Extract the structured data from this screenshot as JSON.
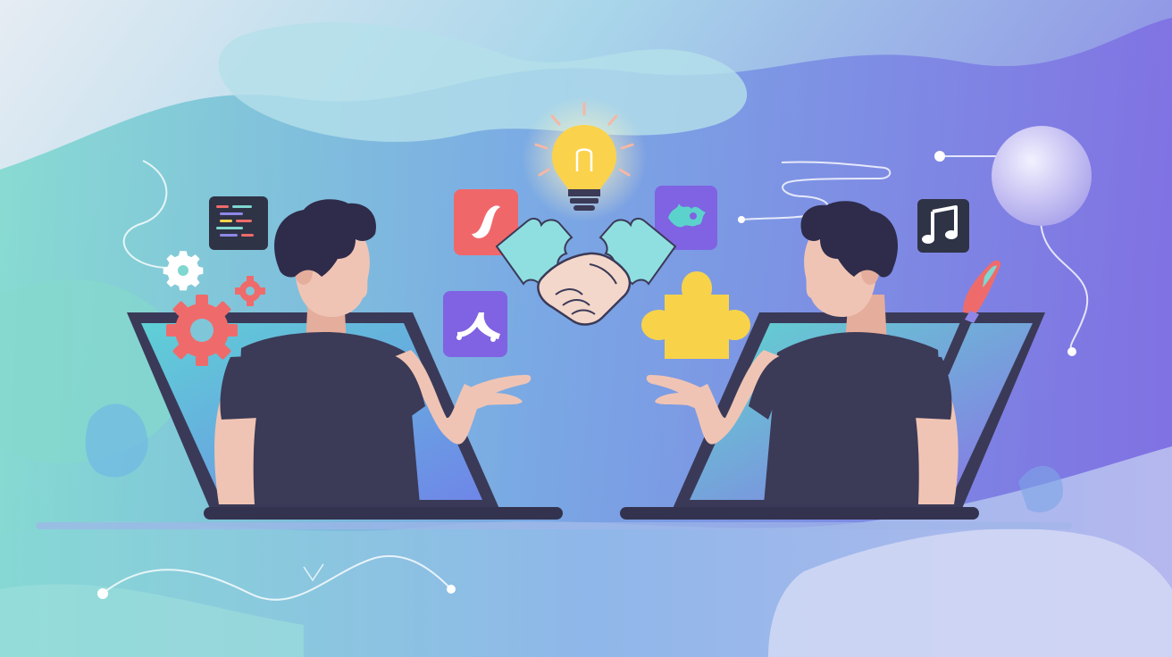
{
  "scene": {
    "kind": "flat vector illustration",
    "palette": {
      "sky_light": "#e3eaf3",
      "teal": "#7fd7d0",
      "blue": "#7d9fe3",
      "violet": "#7c6fe0",
      "laptop_frame": "#3a3a58",
      "screen_left": "#6aa6e8",
      "screen_right": "#8a7ee8",
      "shirt": "#3b3a57",
      "hair": "#2e2c4a",
      "skin": "#f0c4b4",
      "gear_red": "#ef6b6b",
      "puzzle_yellow": "#f8d34a",
      "puzzle_teal": "#8fdfe0",
      "bulb_yellow": "#fbd24b",
      "tile_red": "#f0676a",
      "tile_purple": "#7f63e2",
      "tile_dark": "#2f3346"
    },
    "icons": [
      "code-editor-icon",
      "gear-icon",
      "lightbulb-icon",
      "handshake-icon",
      "puzzle-piece-icon",
      "music-note-icon",
      "paintbrush-icon"
    ]
  }
}
